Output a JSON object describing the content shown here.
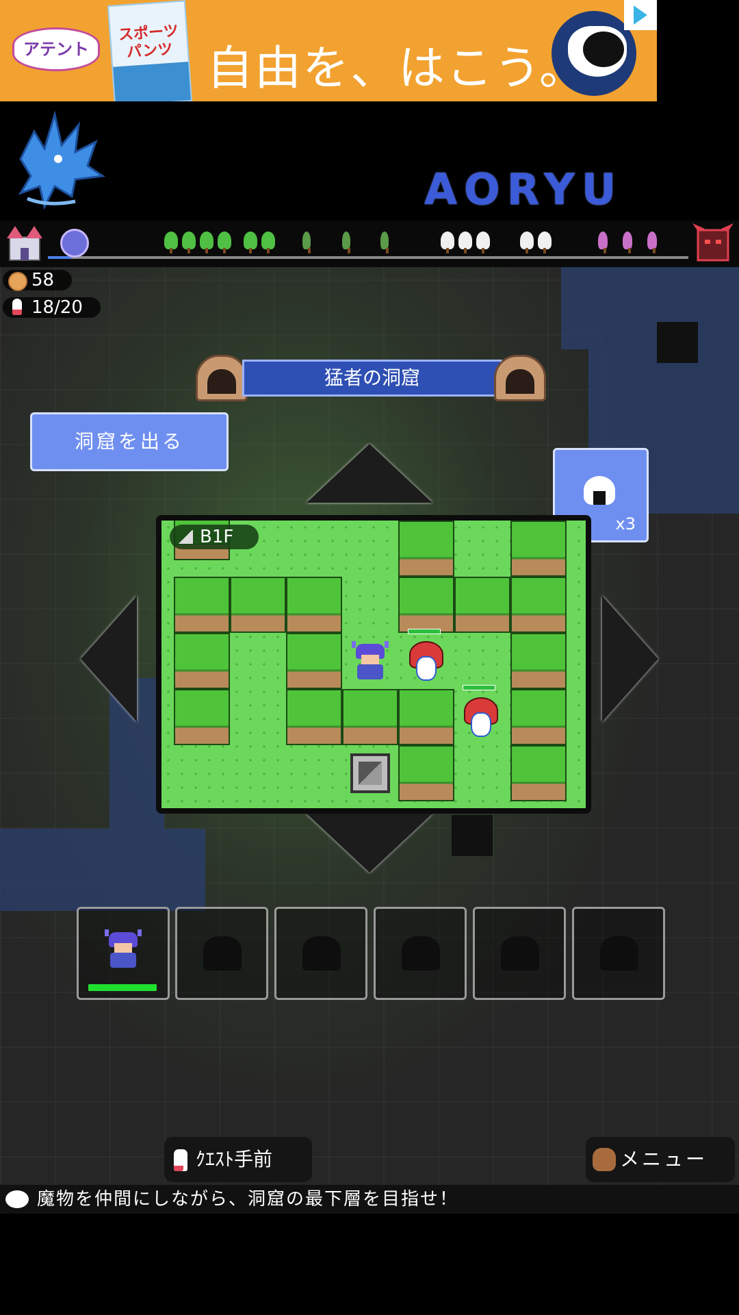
{
  "ad": {
    "brand": "アテント",
    "product": "スポーツパンツ",
    "slogan": "自由を、はこう。"
  },
  "header": {
    "title": "AORYU"
  },
  "stats": {
    "coins": "58",
    "tickets": "18/20"
  },
  "cave": {
    "name": "猛者の洞窟",
    "exit_label": "洞窟を出る"
  },
  "map": {
    "floor": "B1F"
  },
  "item": {
    "count": "x3"
  },
  "party": {
    "slots": 6,
    "hero_hp_fraction": 1.0
  },
  "bottom": {
    "quest_label": "ｸｴｽﾄ手前",
    "menu_label": "メニュー",
    "message": "魔物を仲間にしながら、洞窟の最下層を目指せ！"
  },
  "colors": {
    "accent": "#6f8ff0",
    "banner": "#2e4fb3",
    "grass": "#6bd85b",
    "enemy": "#d93a3a"
  }
}
